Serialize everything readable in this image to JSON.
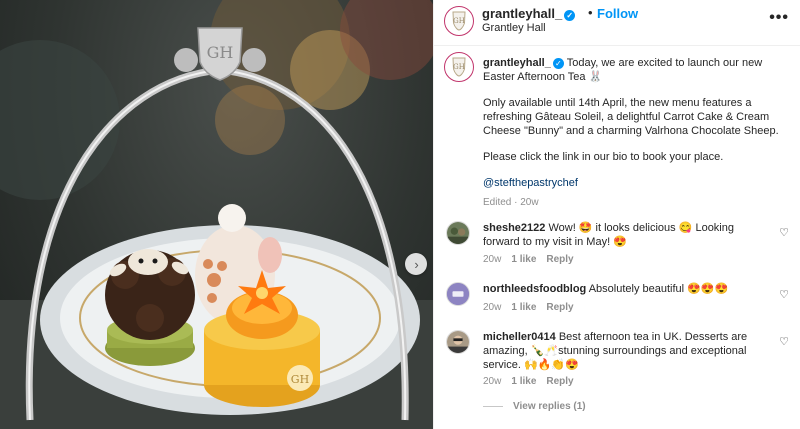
{
  "post": {
    "username": "grantleyhall_",
    "verified_glyph": "✓",
    "dot": "•",
    "follow_label": "Follow",
    "location": "Grantley Hall",
    "more_glyph": "•••",
    "next_glyph": "›",
    "logo_monogram": "GH"
  },
  "caption": {
    "username": "grantleyhall_",
    "line1": " Today, we are excited to launch our new Easter Afternoon Tea 🐰",
    "line2": "Only available until 14th April, the new menu features a refreshing Gâteau Soleil, a delightful Carrot Cake & Cream Cheese \"Bunny\" and a charming Valrhona Chocolate Sheep.",
    "line3": "Please click the link in our bio to book your place.",
    "mention": "@stefthepastrychef",
    "edited": "Edited · 20w"
  },
  "comments": [
    {
      "username": "sheshe2122",
      "text": " Wow! 🤩 it looks delicious 😋 Looking forward to my visit in May! 😍",
      "time": "20w",
      "likes": "1 like",
      "reply": "Reply",
      "heart": "♡",
      "avatar_color": "#6b7a5a"
    },
    {
      "username": "northleedsfoodblog",
      "text": " Absolutely beautiful 😍😍😍",
      "time": "20w",
      "likes": "1 like",
      "reply": "Reply",
      "heart": "♡",
      "avatar_color": "#8d84c2"
    },
    {
      "username": "micheller0414",
      "text": " Best afternoon tea in UK. Desserts are amazing, 🍾🥂stunning surroundings and exceptional service. 🙌🔥👏😍",
      "time": "20w",
      "likes": "1 like",
      "reply": "Reply",
      "heart": "♡",
      "avatar_color": "#a89a86"
    }
  ],
  "view_replies": "View replies (1)",
  "colors": {
    "accent": "#0095f6",
    "ring": "#c1346b",
    "muted": "#8e8e8e"
  }
}
